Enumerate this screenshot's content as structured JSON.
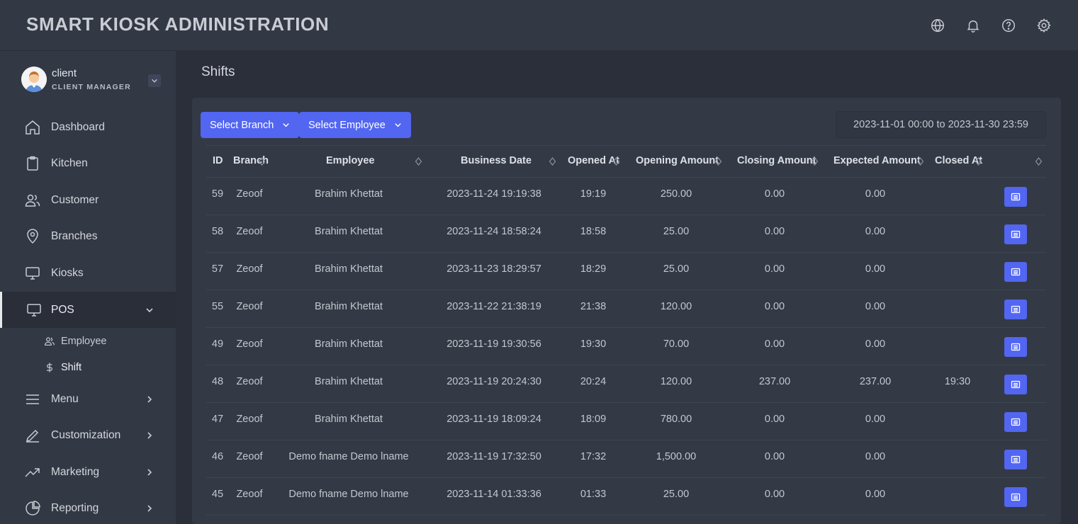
{
  "app": {
    "title": "SMART KIOSK ADMINISTRATION"
  },
  "user": {
    "name": "client",
    "role": "CLIENT MANAGER"
  },
  "nav": {
    "dashboard": "Dashboard",
    "kitchen": "Kitchen",
    "customer": "Customer",
    "branches": "Branches",
    "kiosks": "Kiosks",
    "pos": "POS",
    "pos_employee": "Employee",
    "pos_shift": "Shift",
    "menu": "Menu",
    "customization": "Customization",
    "marketing": "Marketing",
    "reporting": "Reporting"
  },
  "page": {
    "title": "Shifts"
  },
  "filters": {
    "branch_label": "Select Branch",
    "employee_label": "Select Employee",
    "date_range": "2023-11-01 00:00 to 2023-11-30 23:59"
  },
  "table": {
    "headers": {
      "id": "ID",
      "branch": "Branch",
      "employee": "Employee",
      "business_date": "Business Date",
      "opened_at": "Opened At",
      "opening_amount": "Opening Amount",
      "closing_amount": "Closing Amount",
      "expected_amount": "Expected Amount",
      "closed_at": "Closed At"
    },
    "rows": [
      {
        "id": "59",
        "branch": "Zeoof",
        "employee": "Brahim Khettat",
        "business_date": "2023-11-24 19:19:38",
        "opened_at": "19:19",
        "opening_amount": "250.00",
        "closing_amount": "0.00",
        "expected_amount": "0.00",
        "closed_at": ""
      },
      {
        "id": "58",
        "branch": "Zeoof",
        "employee": "Brahim Khettat",
        "business_date": "2023-11-24 18:58:24",
        "opened_at": "18:58",
        "opening_amount": "25.00",
        "closing_amount": "0.00",
        "expected_amount": "0.00",
        "closed_at": ""
      },
      {
        "id": "57",
        "branch": "Zeoof",
        "employee": "Brahim Khettat",
        "business_date": "2023-11-23 18:29:57",
        "opened_at": "18:29",
        "opening_amount": "25.00",
        "closing_amount": "0.00",
        "expected_amount": "0.00",
        "closed_at": ""
      },
      {
        "id": "55",
        "branch": "Zeoof",
        "employee": "Brahim Khettat",
        "business_date": "2023-11-22 21:38:19",
        "opened_at": "21:38",
        "opening_amount": "120.00",
        "closing_amount": "0.00",
        "expected_amount": "0.00",
        "closed_at": ""
      },
      {
        "id": "49",
        "branch": "Zeoof",
        "employee": "Brahim Khettat",
        "business_date": "2023-11-19 19:30:56",
        "opened_at": "19:30",
        "opening_amount": "70.00",
        "closing_amount": "0.00",
        "expected_amount": "0.00",
        "closed_at": ""
      },
      {
        "id": "48",
        "branch": "Zeoof",
        "employee": "Brahim Khettat",
        "business_date": "2023-11-19 20:24:30",
        "opened_at": "20:24",
        "opening_amount": "120.00",
        "closing_amount": "237.00",
        "expected_amount": "237.00",
        "closed_at": "19:30"
      },
      {
        "id": "47",
        "branch": "Zeoof",
        "employee": "Brahim Khettat",
        "business_date": "2023-11-19 18:09:24",
        "opened_at": "18:09",
        "opening_amount": "780.00",
        "closing_amount": "0.00",
        "expected_amount": "0.00",
        "closed_at": ""
      },
      {
        "id": "46",
        "branch": "Zeoof",
        "employee": "Demo fname Demo lname",
        "business_date": "2023-11-19 17:32:50",
        "opened_at": "17:32",
        "opening_amount": "1,500.00",
        "closing_amount": "0.00",
        "expected_amount": "0.00",
        "closed_at": ""
      },
      {
        "id": "45",
        "branch": "Zeoof",
        "employee": "Demo fname Demo lname",
        "business_date": "2023-11-14 01:33:36",
        "opened_at": "01:33",
        "opening_amount": "25.00",
        "closing_amount": "0.00",
        "expected_amount": "0.00",
        "closed_at": ""
      }
    ]
  },
  "colors": {
    "accent": "#5266f2",
    "background": "#2b2f3a",
    "panel": "#333845"
  }
}
